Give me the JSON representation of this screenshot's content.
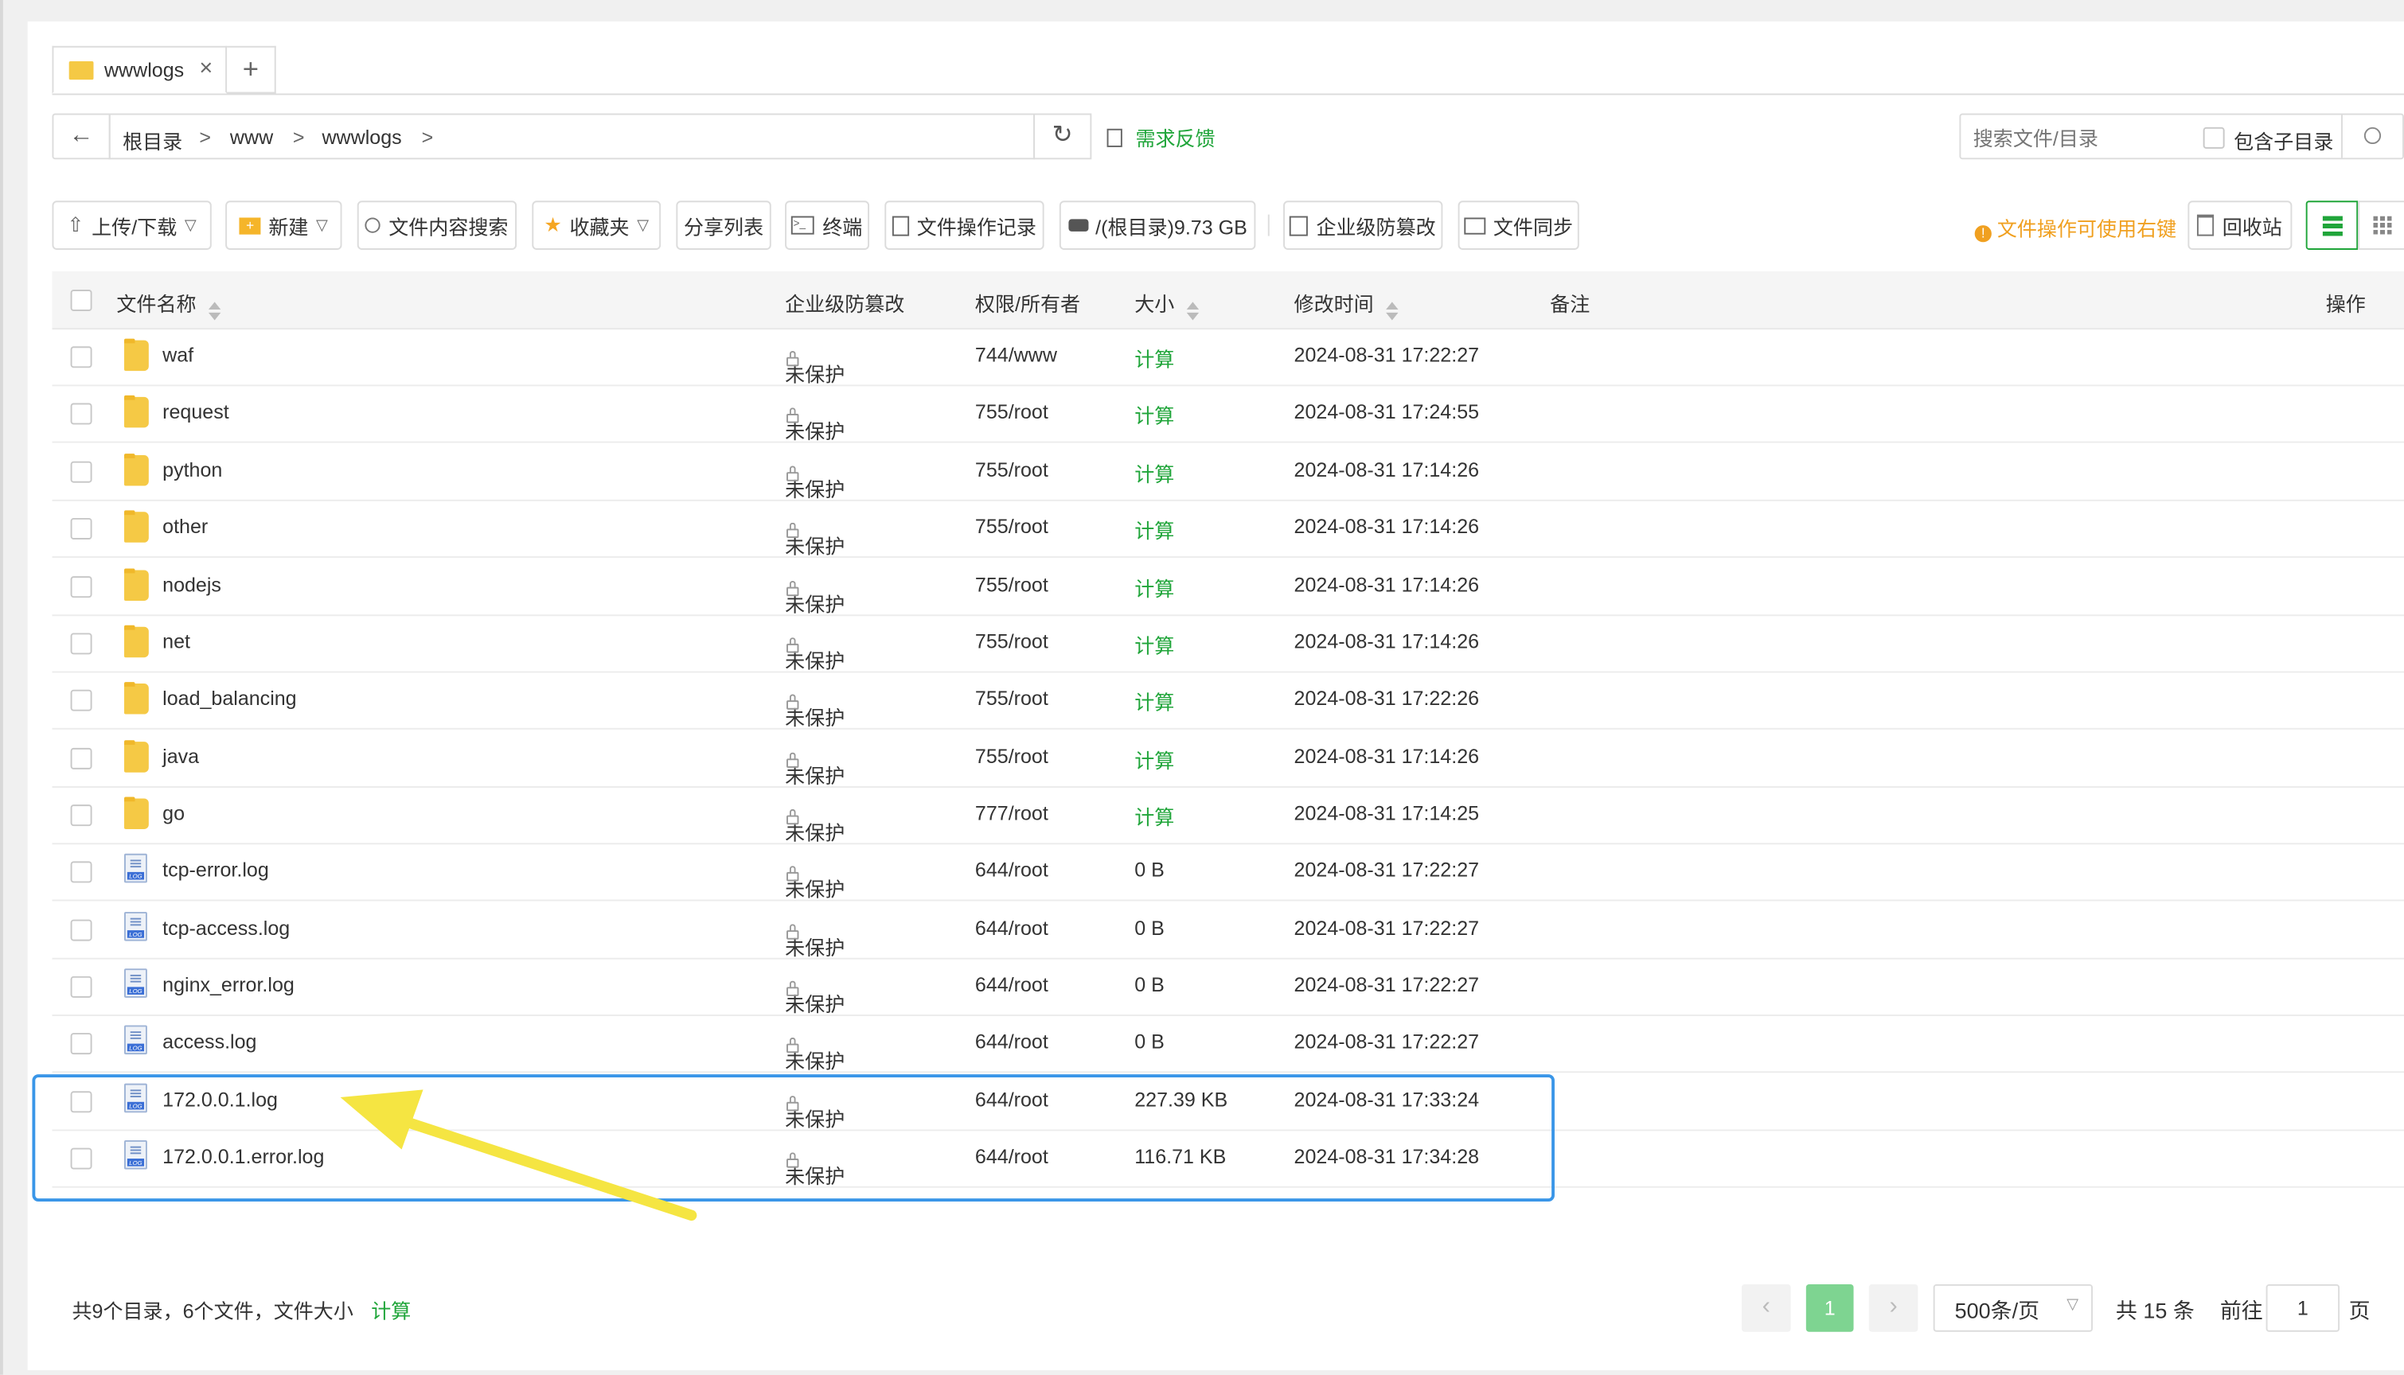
{
  "tab": {
    "label": "wwwlogs",
    "close": "×",
    "add": "+"
  },
  "breadcrumb": {
    "back": "←",
    "items": [
      "根目录",
      "www",
      "wwwlogs"
    ],
    "sep": ">",
    "refresh": "↻",
    "feedback": "需求反馈"
  },
  "search": {
    "placeholder": "搜索文件/目录",
    "include_sub": "包含子目录"
  },
  "toolbar": {
    "upload": "上传/下载",
    "new": "新建",
    "content_search": "文件内容搜索",
    "favorites": "收藏夹",
    "share_list": "分享列表",
    "terminal": "终端",
    "op_log": "文件操作记录",
    "disk": "/(根目录)9.73 GB",
    "tamper": "企业级防篡改",
    "sync": "文件同步",
    "tip": "文件操作可使用右键",
    "recycle": "回收站"
  },
  "columns": {
    "name": "文件名称",
    "tamper": "企业级防篡改",
    "perm": "权限/所有者",
    "size": "大小",
    "mtime": "修改时间",
    "remark": "备注",
    "action": "操作"
  },
  "rows": [
    {
      "name": "waf",
      "type": "folder",
      "tamper": "未保护",
      "perm": "744/www",
      "size": "计算",
      "mtime": "2024-08-31 17:22:27"
    },
    {
      "name": "request",
      "type": "folder",
      "tamper": "未保护",
      "perm": "755/root",
      "size": "计算",
      "mtime": "2024-08-31 17:24:55"
    },
    {
      "name": "python",
      "type": "folder",
      "tamper": "未保护",
      "perm": "755/root",
      "size": "计算",
      "mtime": "2024-08-31 17:14:26"
    },
    {
      "name": "other",
      "type": "folder",
      "tamper": "未保护",
      "perm": "755/root",
      "size": "计算",
      "mtime": "2024-08-31 17:14:26"
    },
    {
      "name": "nodejs",
      "type": "folder",
      "tamper": "未保护",
      "perm": "755/root",
      "size": "计算",
      "mtime": "2024-08-31 17:14:26"
    },
    {
      "name": "net",
      "type": "folder",
      "tamper": "未保护",
      "perm": "755/root",
      "size": "计算",
      "mtime": "2024-08-31 17:14:26"
    },
    {
      "name": "load_balancing",
      "type": "folder",
      "tamper": "未保护",
      "perm": "755/root",
      "size": "计算",
      "mtime": "2024-08-31 17:22:26"
    },
    {
      "name": "java",
      "type": "folder",
      "tamper": "未保护",
      "perm": "755/root",
      "size": "计算",
      "mtime": "2024-08-31 17:14:26"
    },
    {
      "name": "go",
      "type": "folder",
      "tamper": "未保护",
      "perm": "777/root",
      "size": "计算",
      "mtime": "2024-08-31 17:14:25"
    },
    {
      "name": "tcp-error.log",
      "type": "file",
      "tamper": "未保护",
      "perm": "644/root",
      "size": "0 B",
      "mtime": "2024-08-31 17:22:27"
    },
    {
      "name": "tcp-access.log",
      "type": "file",
      "tamper": "未保护",
      "perm": "644/root",
      "size": "0 B",
      "mtime": "2024-08-31 17:22:27"
    },
    {
      "name": "nginx_error.log",
      "type": "file",
      "tamper": "未保护",
      "perm": "644/root",
      "size": "0 B",
      "mtime": "2024-08-31 17:22:27"
    },
    {
      "name": "access.log",
      "type": "file",
      "tamper": "未保护",
      "perm": "644/root",
      "size": "0 B",
      "mtime": "2024-08-31 17:22:27"
    },
    {
      "name": "172.0.0.1.log",
      "type": "file",
      "tamper": "未保护",
      "perm": "644/root",
      "size": "227.39 KB",
      "mtime": "2024-08-31 17:33:24"
    },
    {
      "name": "172.0.0.1.error.log",
      "type": "file",
      "tamper": "未保护",
      "perm": "644/root",
      "size": "116.71 KB",
      "mtime": "2024-08-31 17:34:28"
    }
  ],
  "footer": {
    "summary": "共9个目录，6个文件，文件大小",
    "calc": "计算",
    "prev": "‹",
    "page": "1",
    "next": "›",
    "per_page": "500条/页",
    "total": "共 15 条",
    "goto_label": "前往",
    "goto_value": "1",
    "page_unit": "页"
  },
  "colors": {
    "accent": "#20a53a",
    "warning": "#f0a020",
    "highlight": "#3a96e8",
    "arrow": "#f5e542"
  }
}
